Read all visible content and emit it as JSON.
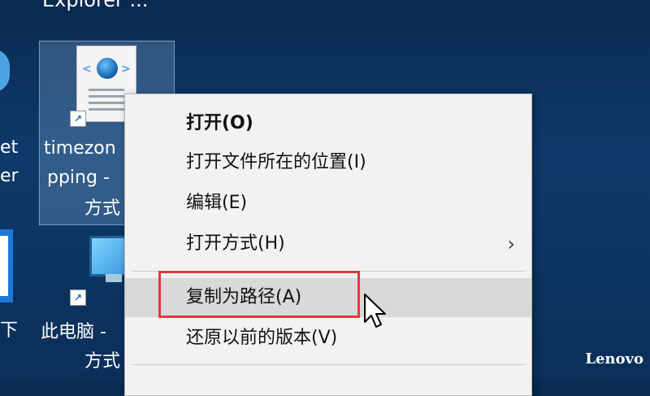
{
  "desktop": {
    "top_fragment": "Explorer    ...",
    "left_fragments": [
      "et",
      "er",
      "下"
    ],
    "shortcut_arrow": "↗",
    "icon_1": {
      "label_line1": "timezon",
      "label_line2": "pping -",
      "label_line3": "方式"
    },
    "icon_2": {
      "label_line1": "此电脑 -",
      "label_line2": "方式"
    }
  },
  "context_menu": {
    "items": [
      {
        "label": "打开(O)"
      },
      {
        "label": "打开文件所在的位置(I)"
      },
      {
        "label": "编辑(E)"
      },
      {
        "label": "打开方式(H)",
        "submenu_arrow": "›"
      },
      {
        "label": "复制为路径(A)"
      },
      {
        "label": "还原以前的版本(V)"
      }
    ]
  },
  "watermark": "Lenovo",
  "colors": {
    "highlight_box": "#e13b3b",
    "menu_bg": "#f2f2f2",
    "hover_bg": "#d9d9d9"
  }
}
